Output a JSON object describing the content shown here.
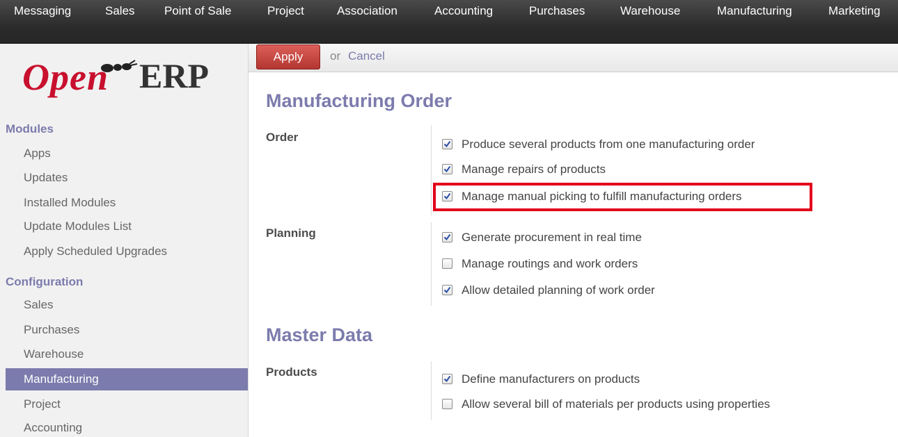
{
  "topmenu": [
    "Messaging",
    "Sales",
    "Point of Sale",
    "Project",
    "Association",
    "Accounting",
    "Purchases",
    "Warehouse",
    "Manufacturing",
    "Marketing"
  ],
  "logo": {
    "part1": "Open",
    "part2": "ERP"
  },
  "sidebar": {
    "modules_title": "Modules",
    "modules_items": [
      "Apps",
      "Updates",
      "Installed Modules",
      "Update Modules List",
      "Apply Scheduled Upgrades"
    ],
    "config_title": "Configuration",
    "config_items": [
      "Sales",
      "Purchases",
      "Warehouse",
      "Manufacturing",
      "Project",
      "Accounting"
    ],
    "active_item": "Manufacturing"
  },
  "actions": {
    "apply_label": "Apply",
    "or_text": "or",
    "cancel_label": "Cancel"
  },
  "sections": [
    {
      "title": "Manufacturing Order",
      "groups": [
        {
          "label": "Order",
          "options": [
            {
              "text": "Produce several products from one manufacturing order",
              "checked": true
            },
            {
              "text": "Manage repairs of products",
              "checked": true
            },
            {
              "text": "Manage manual picking to fulfill manufacturing orders",
              "checked": true
            }
          ]
        },
        {
          "label": "Planning",
          "options": [
            {
              "text": "Generate procurement in real time",
              "checked": true
            },
            {
              "text": "Manage routings and work orders",
              "checked": false
            },
            {
              "text": "Allow detailed planning of work order",
              "checked": true
            }
          ]
        }
      ]
    },
    {
      "title": "Master Data",
      "groups": [
        {
          "label": "Products",
          "options": [
            {
              "text": "Define manufacturers on products",
              "checked": true
            },
            {
              "text": "Allow several bill of materials per products using properties",
              "checked": false
            }
          ]
        }
      ]
    }
  ],
  "colors": {
    "accent": "#7c7bad",
    "apply": "#c33a34",
    "highlight": "#e3001b",
    "topbar": "#2c2c2c"
  }
}
